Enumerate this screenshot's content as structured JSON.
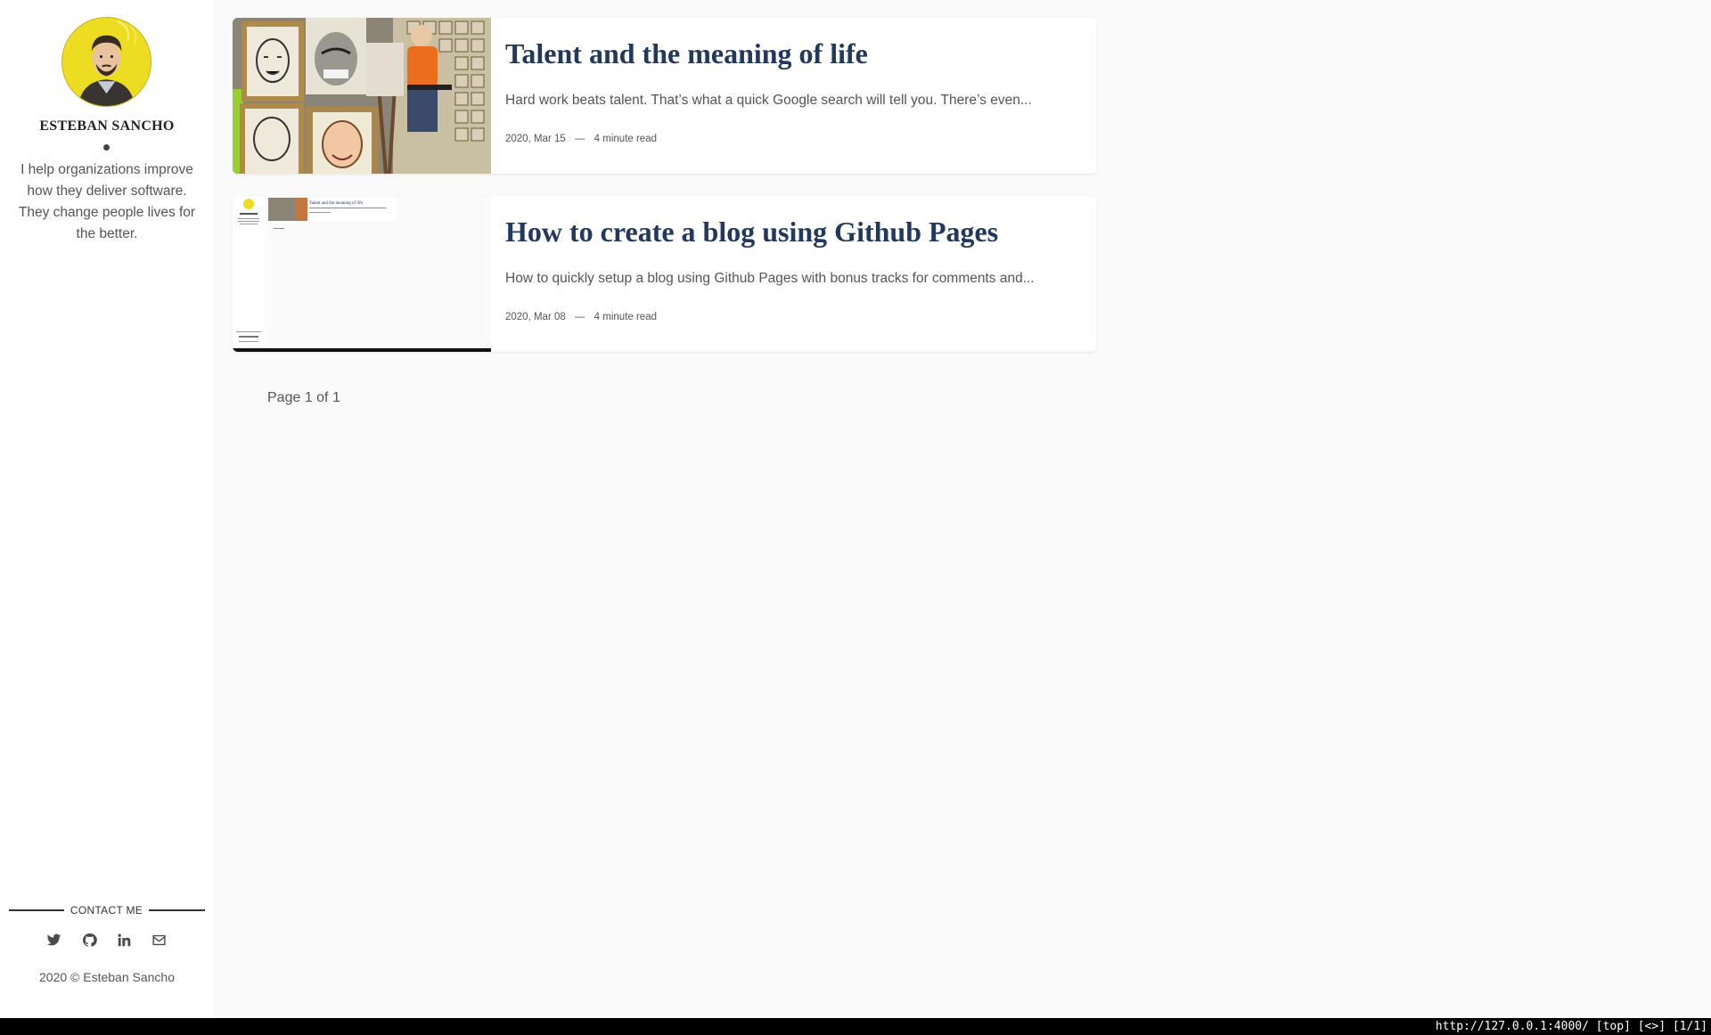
{
  "sidebar": {
    "author_name": "ESTEBAN SANCHO",
    "bio": "I help organizations improve how they deliver software. They change people lives for the better.",
    "contact_label": "CONTACT ME",
    "social_icons": [
      "twitter-icon",
      "github-icon",
      "linkedin-icon",
      "envelope-icon"
    ],
    "copyright": "2020 © Esteban Sancho"
  },
  "posts": [
    {
      "title": "Talent and the meaning of life",
      "excerpt": "Hard work beats talent. That’s what a quick Google search will tell you. There’s even...",
      "date": "2020, Mar 15",
      "separator": "—",
      "read_time": "4 minute read",
      "thumbnail": "caricature-artist-photo"
    },
    {
      "title": "How to create a blog using Github Pages",
      "excerpt": "How to quickly setup a blog using Github Pages with bonus tracks for comments and...",
      "date": "2020, Mar 08",
      "separator": "—",
      "read_time": "4 minute read",
      "thumbnail": "blog-screenshot-thumbnail",
      "thumbnail_text": "Talent and the meaning of life"
    }
  ],
  "pagination": {
    "text": "Page 1 of 1"
  },
  "statusbar": {
    "text": "http://127.0.0.1:4000/ [top] [<>] [1/1]"
  },
  "colors": {
    "title": "#22385d",
    "background": "#fafafa",
    "avatar_bg": "#eddc24"
  }
}
